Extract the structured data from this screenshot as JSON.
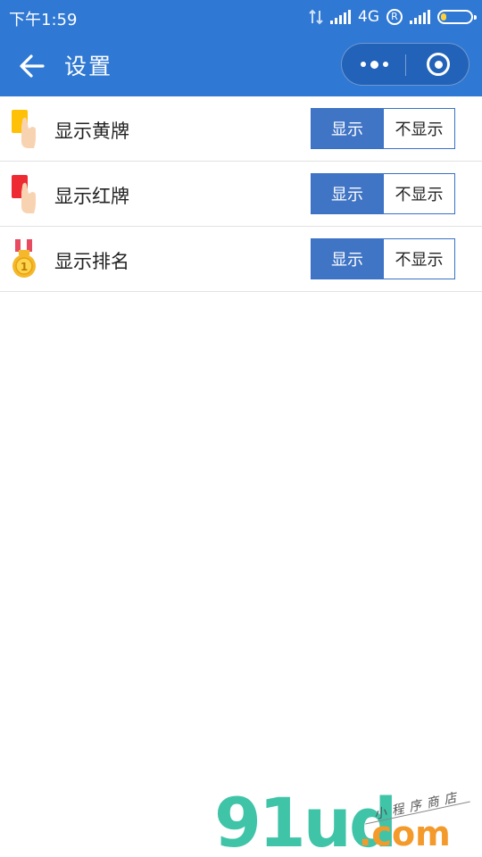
{
  "status_bar": {
    "time": "下午1:59",
    "network": "4G",
    "roaming": "R"
  },
  "nav": {
    "title": "设置"
  },
  "settings": [
    {
      "label": "显示黄牌",
      "icon": "yellow-card-icon",
      "on_label": "显示",
      "off_label": "不显示",
      "selected": "on"
    },
    {
      "label": "显示红牌",
      "icon": "red-card-icon",
      "on_label": "显示",
      "off_label": "不显示",
      "selected": "on"
    },
    {
      "label": "显示排名",
      "icon": "medal-icon",
      "on_label": "显示",
      "off_label": "不显示",
      "selected": "on"
    }
  ],
  "watermark": {
    "brand": "91ud",
    "domain": ".com",
    "tagline": "小程序商店"
  },
  "colors": {
    "header": "#2f78d3",
    "toggle_on": "#4074c4",
    "yellow_card": "#ffc107",
    "red_card": "#ee2a32",
    "medal_gold": "#f5b82a"
  }
}
